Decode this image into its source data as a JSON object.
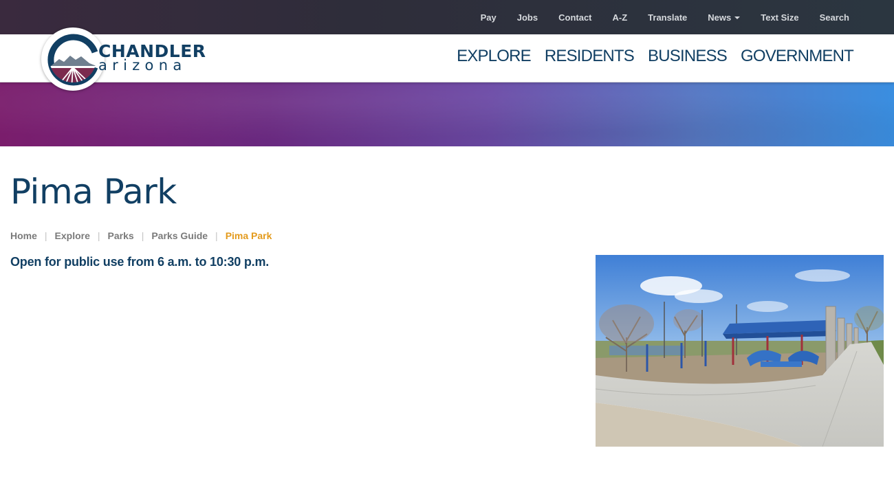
{
  "utility_nav": {
    "items": [
      {
        "id": "pay",
        "label": "Pay"
      },
      {
        "id": "jobs",
        "label": "Jobs"
      },
      {
        "id": "contact",
        "label": "Contact"
      },
      {
        "id": "az",
        "label": "A-Z"
      },
      {
        "id": "translate",
        "label": "Translate"
      },
      {
        "id": "news",
        "label": "News"
      },
      {
        "id": "text-size",
        "label": "Text Size"
      },
      {
        "id": "search",
        "label": "Search"
      }
    ]
  },
  "logo": {
    "line1": "CHANDLER",
    "line2": "arizona"
  },
  "main_nav": {
    "items": [
      {
        "id": "explore",
        "label": "EXPLORE"
      },
      {
        "id": "residents",
        "label": "RESIDENTS"
      },
      {
        "id": "business",
        "label": "BUSINESS"
      },
      {
        "id": "government",
        "label": "GOVERNMENT"
      }
    ]
  },
  "page": {
    "title": "Pima Park",
    "hours": "Open for public use from 6 a.m. to 10:30 p.m."
  },
  "breadcrumb": {
    "items": [
      "Home",
      "Explore",
      "Parks",
      "Parks Guide"
    ],
    "current": "Pima Park"
  },
  "colors": {
    "brand_navy": "#113f63",
    "breadcrumb_active": "#e39a1c",
    "logo_maroon": "#7b2a4e"
  }
}
